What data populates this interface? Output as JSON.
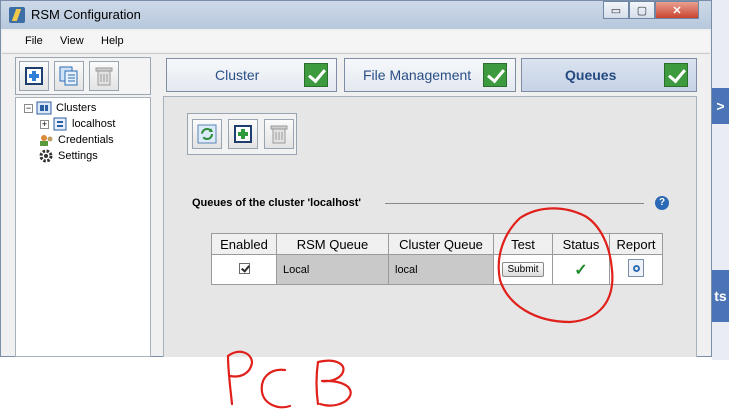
{
  "window": {
    "title": "RSM Configuration",
    "controls": {
      "minimize": "▭",
      "maximize": "▢",
      "close": "✕"
    }
  },
  "menu": {
    "items": [
      "File",
      "View",
      "Help"
    ]
  },
  "tree": {
    "clusters_label": "Clusters",
    "localhost_label": "localhost",
    "credentials_label": "Credentials",
    "settings_label": "Settings"
  },
  "tabs": [
    {
      "label": "Cluster",
      "checked": true
    },
    {
      "label": "File Management",
      "checked": true
    },
    {
      "label": "Queues",
      "checked": true,
      "active": true
    }
  ],
  "queues": {
    "title": "Queues of the cluster 'localhost'",
    "help": "?",
    "columns": [
      "Enabled",
      "RSM Queue",
      "Cluster Queue",
      "Test",
      "Status",
      "Report"
    ],
    "rows": [
      {
        "enabled": true,
        "rsm_queue": "Local",
        "cluster_queue": "local",
        "test_button": "Submit",
        "status": "✓"
      }
    ]
  },
  "right_edge": {
    "tab1": ">",
    "tab2": "ts"
  },
  "annotation": {
    "handwriting": "PCB",
    "color": "#e0201b"
  },
  "colors": {
    "accent": "#2a4f86",
    "check_green": "#3e9a3e",
    "status_green": "#1f8a2b"
  }
}
